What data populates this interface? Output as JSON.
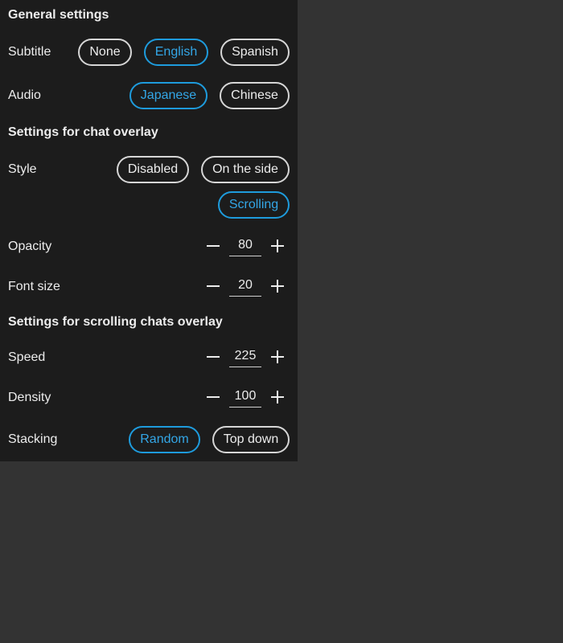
{
  "general": {
    "heading": "General settings",
    "subtitle": {
      "label": "Subtitle",
      "options": [
        "None",
        "English",
        "Spanish"
      ],
      "selected": "English"
    },
    "audio": {
      "label": "Audio",
      "options": [
        "Japanese",
        "Chinese"
      ],
      "selected": "Japanese"
    }
  },
  "chat_overlay": {
    "heading": "Settings for chat overlay",
    "style": {
      "label": "Style",
      "options": [
        "Disabled",
        "On the side",
        "Scrolling"
      ],
      "selected": "Scrolling"
    },
    "opacity": {
      "label": "Opacity",
      "value": "80"
    },
    "font_size": {
      "label": "Font size",
      "value": "20"
    }
  },
  "scrolling_overlay": {
    "heading": "Settings for scrolling chats overlay",
    "speed": {
      "label": "Speed",
      "value": "225"
    },
    "density": {
      "label": "Density",
      "value": "100"
    },
    "stacking": {
      "label": "Stacking",
      "options": [
        "Random",
        "Top down"
      ],
      "selected": "Random"
    }
  },
  "icons": {
    "decrement": "minus-icon",
    "increment": "plus-icon"
  },
  "colors": {
    "page_background": "#333333",
    "panel_background": "#1c1c1c",
    "text": "#ececec",
    "accent": "#1e9bdc",
    "pill_border": "#d6d6d6"
  }
}
